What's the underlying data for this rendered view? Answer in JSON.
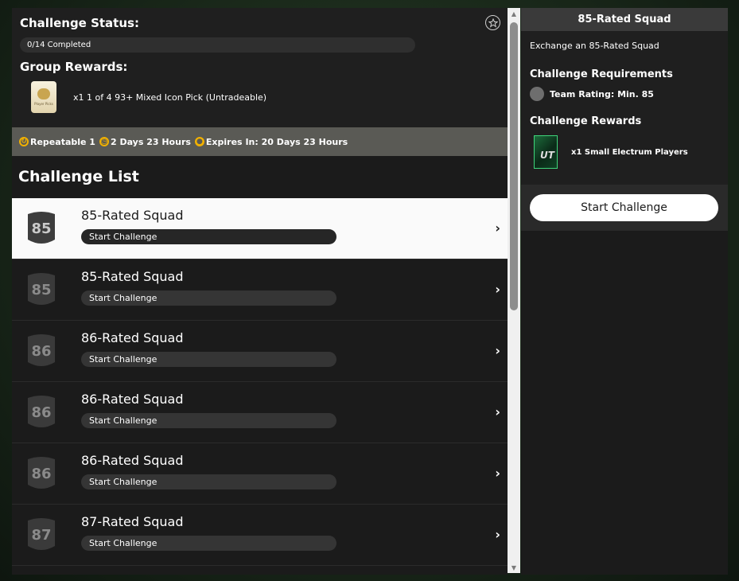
{
  "status": {
    "title": "Challenge Status:",
    "progress_label": "0/14 Completed",
    "rewards_title": "Group Rewards:",
    "pack_label": "Player Picks",
    "reward_text": "x1 1 of 4 93+ Mixed Icon Pick (Untradeable)"
  },
  "info_strip": {
    "repeatable": "Repeatable 1",
    "refresh": "2 Days 23 Hours",
    "expires": "Expires In: 20 Days 23 Hours"
  },
  "list": {
    "heading": "Challenge List",
    "rows": [
      {
        "rating": "85",
        "title": "85-Rated Squad",
        "action": "Start Challenge"
      },
      {
        "rating": "85",
        "title": "85-Rated Squad",
        "action": "Start Challenge"
      },
      {
        "rating": "86",
        "title": "86-Rated Squad",
        "action": "Start Challenge"
      },
      {
        "rating": "86",
        "title": "86-Rated Squad",
        "action": "Start Challenge"
      },
      {
        "rating": "86",
        "title": "86-Rated Squad",
        "action": "Start Challenge"
      },
      {
        "rating": "87",
        "title": "87-Rated Squad",
        "action": "Start Challenge"
      }
    ]
  },
  "detail": {
    "title": "85-Rated Squad",
    "description": "Exchange an 85-Rated Squad",
    "requirements_title": "Challenge Requirements",
    "requirement": "Team Rating: Min. 85",
    "rewards_title": "Challenge Rewards",
    "pack_logo": "UT",
    "reward": "x1 Small Electrum Players",
    "start_label": "Start Challenge"
  },
  "icons": {
    "favorite": "star-icon",
    "repeat": "repeat-icon",
    "refresh": "refresh-timer-icon",
    "expires": "stopwatch-icon",
    "chevron": "chevron-right-icon"
  },
  "colors": {
    "accent": "#f2b100",
    "selected_row": "#fafafa",
    "electrum": "#3ed57a"
  }
}
